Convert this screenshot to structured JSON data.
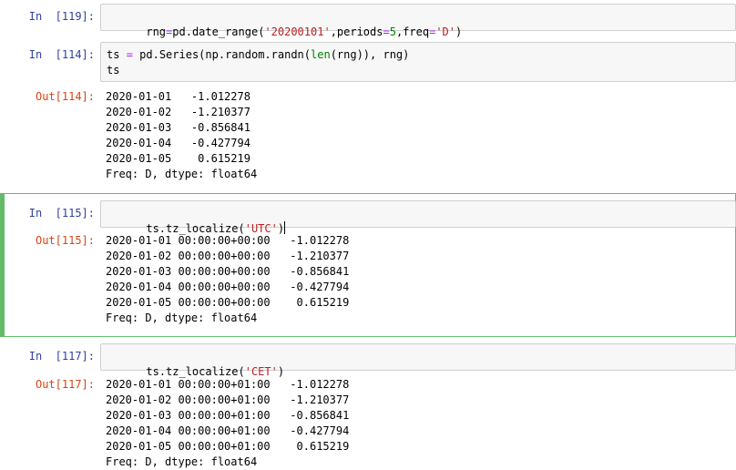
{
  "cells": [
    {
      "in_prompt": "In  [119]:",
      "code": [
        {
          "t": "rng",
          "c": ""
        },
        {
          "t": "=",
          "c": "op"
        },
        {
          "t": "pd.date_range(",
          "c": ""
        },
        {
          "t": "'20200101'",
          "c": "str"
        },
        {
          "t": ",periods",
          "c": ""
        },
        {
          "t": "=",
          "c": "op"
        },
        {
          "t": "5",
          "c": "num"
        },
        {
          "t": ",freq",
          "c": ""
        },
        {
          "t": "=",
          "c": "op"
        },
        {
          "t": "'D'",
          "c": "str"
        },
        {
          "t": ")",
          "c": ""
        }
      ]
    },
    {
      "in_prompt": "In  [114]:",
      "code_lines": [
        [
          {
            "t": "ts ",
            "c": ""
          },
          {
            "t": "=",
            "c": "op"
          },
          {
            "t": " pd.Series(np.random.randn(",
            "c": ""
          },
          {
            "t": "len",
            "c": "kw"
          },
          {
            "t": "(rng)), rng)",
            "c": ""
          }
        ],
        [
          {
            "t": "ts",
            "c": ""
          }
        ]
      ],
      "out_prompt": "Out[114]:",
      "output": [
        "2020-01-01   -1.012278",
        "2020-01-02   -1.210377",
        "2020-01-03   -0.856841",
        "2020-01-04   -0.427794",
        "2020-01-05    0.615219",
        "Freq: D, dtype: float64"
      ]
    },
    {
      "in_prompt": "In  [115]:",
      "code": [
        {
          "t": "ts.tz_localize(",
          "c": ""
        },
        {
          "t": "'UTC'",
          "c": "str"
        },
        {
          "t": ")",
          "c": ""
        }
      ],
      "out_prompt": "Out[115]:",
      "output": [
        "2020-01-01 00:00:00+00:00   -1.012278",
        "2020-01-02 00:00:00+00:00   -1.210377",
        "2020-01-03 00:00:00+00:00   -0.856841",
        "2020-01-04 00:00:00+00:00   -0.427794",
        "2020-01-05 00:00:00+00:00    0.615219",
        "Freq: D, dtype: float64"
      ]
    },
    {
      "in_prompt": "In  [117]:",
      "code": [
        {
          "t": "ts.tz_localize(",
          "c": ""
        },
        {
          "t": "'CET'",
          "c": "str"
        },
        {
          "t": ")",
          "c": ""
        }
      ],
      "out_prompt": "Out[117]:",
      "output": [
        "2020-01-01 00:00:00+01:00   -1.012278",
        "2020-01-02 00:00:00+01:00   -1.210377",
        "2020-01-03 00:00:00+01:00   -0.856841",
        "2020-01-04 00:00:00+01:00   -0.427794",
        "2020-01-05 00:00:00+01:00    0.615219",
        "Freq: D, dtype: float64"
      ]
    }
  ]
}
